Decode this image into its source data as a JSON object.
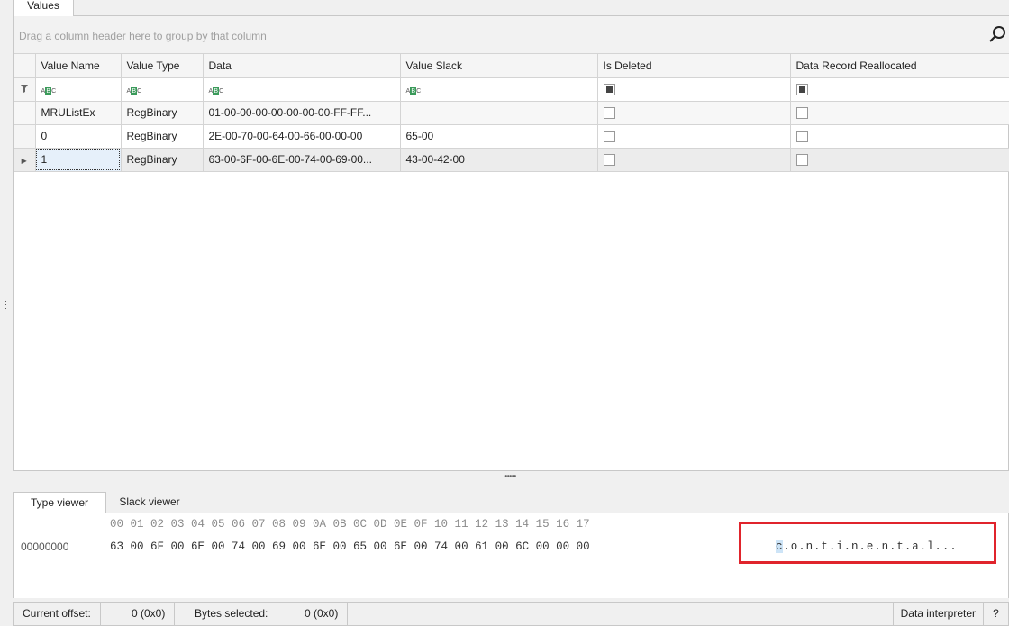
{
  "tabs": {
    "values": "Values"
  },
  "group_panel": {
    "hint": "Drag a column header here to group by that column",
    "search_icon": "search-icon"
  },
  "grid": {
    "columns": [
      "Value Name",
      "Value Type",
      "Data",
      "Value Slack",
      "Is Deleted",
      "Data Record Reallocated"
    ],
    "filter_text_icon": "abc-text-filter-icon",
    "rows": [
      {
        "name": "MRUListEx",
        "type": "RegBinary",
        "data": "01-00-00-00-00-00-00-00-FF-FF...",
        "slack": "",
        "is_deleted": false,
        "reallocated": false
      },
      {
        "name": "0",
        "type": "RegBinary",
        "data": "2E-00-70-00-64-00-66-00-00-00",
        "slack": "65-00",
        "is_deleted": false,
        "reallocated": false
      },
      {
        "name": "1",
        "type": "RegBinary",
        "data": "63-00-6F-00-6E-00-74-00-69-00...",
        "slack": "43-00-42-00",
        "is_deleted": false,
        "reallocated": false
      }
    ]
  },
  "viewer_tabs": {
    "type_viewer": "Type viewer",
    "slack_viewer": "Slack viewer"
  },
  "hex": {
    "header": "00 01 02 03 04 05 06 07 08 09 0A 0B 0C 0D 0E 0F 10 11 12 13 14 15 16 17",
    "offset": "00000000",
    "bytes": "63 00 6F 00 6E 00 74 00 69 00 6E 00 65 00 6E 00 74 00 61 00 6C 00 00 00",
    "ascii_first": "c",
    "ascii_rest": ".o.n.t.i.n.e.n.t.a.l...",
    "highlight_color": "#e0242c"
  },
  "status": {
    "current_offset_label": "Current offset:",
    "current_offset_value": "0 (0x0)",
    "bytes_selected_label": "Bytes selected:",
    "bytes_selected_value": "0 (0x0)",
    "data_interpreter": "Data interpreter",
    "help": "?"
  }
}
